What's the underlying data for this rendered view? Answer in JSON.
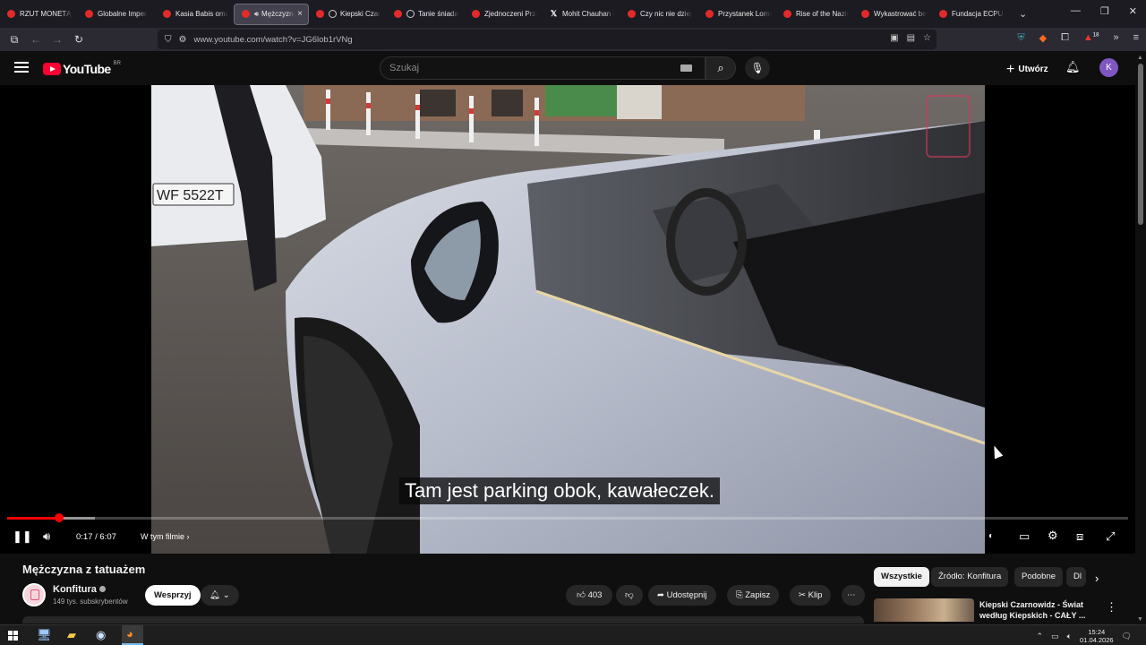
{
  "browser": {
    "tabs": [
      {
        "title": "RZUT MONETĄ |",
        "kind": "yt"
      },
      {
        "title": "Globalne Imperi",
        "kind": "yt"
      },
      {
        "title": "Kasia Babis oma",
        "kind": "yt"
      },
      {
        "title": "Mężczyzna",
        "kind": "yt-active"
      },
      {
        "title": "Kiepski Czar",
        "kind": "yt-sub"
      },
      {
        "title": "Tanie śniada",
        "kind": "yt-sub"
      },
      {
        "title": "Zjednoczeni Prze",
        "kind": "yt"
      },
      {
        "title": "Mohit Chauhan -",
        "kind": "x"
      },
      {
        "title": "Czy nic nie dziej",
        "kind": "yt"
      },
      {
        "title": "Przystanek Lomb",
        "kind": "yt"
      },
      {
        "title": "Rise of the Nazis",
        "kind": "yt"
      },
      {
        "title": "Wykastrować be",
        "kind": "yt"
      },
      {
        "title": "Fundacja ECPU F",
        "kind": "yt"
      }
    ],
    "close_glyph": "×",
    "url": "www.youtube.com/watch?v=JG6lob1rVNg",
    "ext_badge": "18"
  },
  "youtube": {
    "logo_text": "YouTube",
    "country_code": "BR",
    "search_placeholder": "Szukaj",
    "create_label": "Utwórz",
    "avatar_letter": "K"
  },
  "player": {
    "caption": "Tam jest parking obok, kawałeczek.",
    "time_current": "0:17",
    "time_total": "6:07",
    "time_sep": " / ",
    "chapter_label": "W tym filmie",
    "played_fraction": 0.046,
    "loaded_fraction": 0.078,
    "plate_text": "WF 5522T"
  },
  "video": {
    "title": "Mężczyzna z tatuażem",
    "channel": "Konfitura",
    "subscribers": "149 tys. subskrybentów",
    "support_label": "Wesprzyj",
    "likes": "403",
    "share_label": "Udostępnij",
    "save_label": "Zapisz",
    "clip_label": "Klip"
  },
  "sidebar": {
    "chips": [
      "Wszystkie",
      "Źródło: Konfitura",
      "Podobne",
      "Dl"
    ],
    "recommendation_title": "Kiepski Czarnowidz - Świat według Kiepskich - CAŁY ..."
  },
  "taskbar": {
    "time": "15:24",
    "date": "01.04.2026"
  },
  "colors": {
    "accent_red": "#ff0033",
    "progress_red": "#ff0000",
    "avatar_purple": "#7e57c2"
  }
}
